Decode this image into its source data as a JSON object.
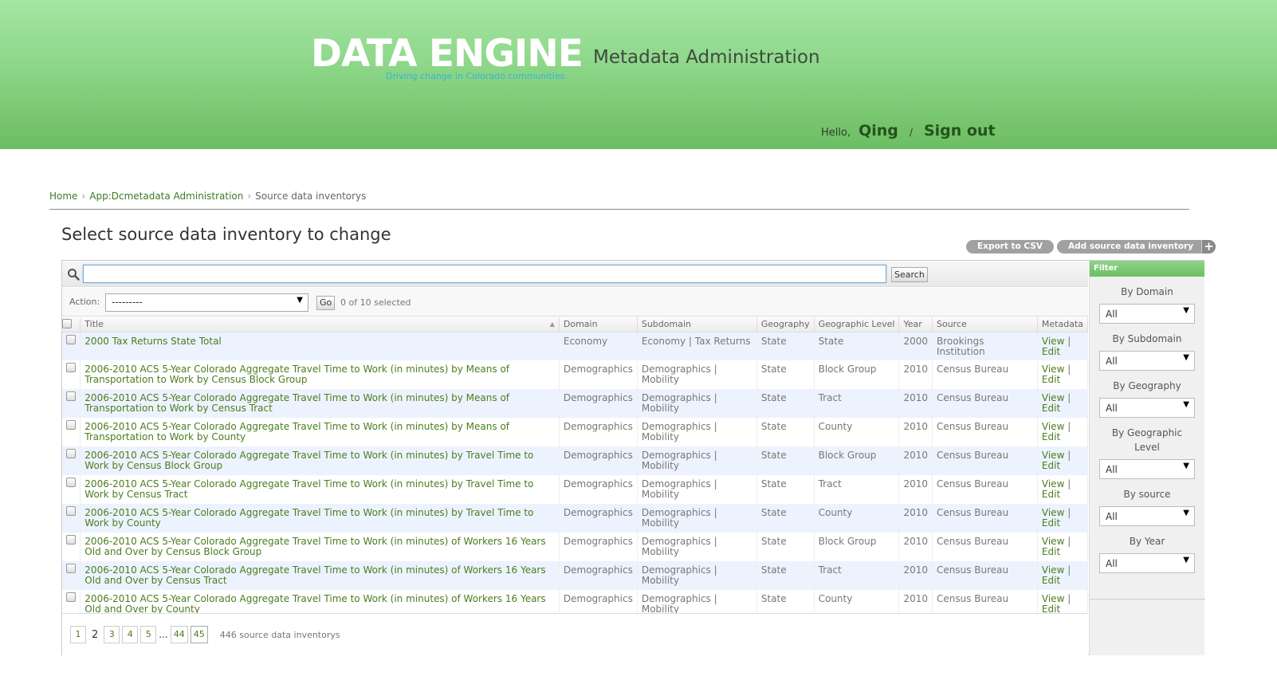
{
  "header": {
    "logo": "DATA ENGINE",
    "tagline": "Driving change in Colorado communities",
    "app_title": "Metadata Administration",
    "greeting": "Hello,",
    "username": "Qing",
    "separator": "/",
    "signout": "Sign out"
  },
  "breadcrumb": {
    "home": "Home",
    "app": "App:Dcmetadata Administration",
    "current": "Source data inventorys",
    "arrow": "›"
  },
  "page_title": "Select source data inventory to change",
  "tools": {
    "export": "Export to CSV",
    "add": "Add source data inventory",
    "add_plus": "+"
  },
  "search": {
    "value": "",
    "placeholder": "",
    "button": "Search"
  },
  "actions": {
    "label": "Action:",
    "selected": "---------",
    "go": "Go",
    "count": "0 of 10 selected"
  },
  "table": {
    "columns": [
      "Title",
      "Domain",
      "Subdomain",
      "Geography",
      "Geographic Level",
      "Year",
      "Source",
      "Metadata"
    ],
    "view_label": "View",
    "edit_label": "Edit",
    "pipe": "|",
    "rows": [
      {
        "title": "2000 Tax Returns State Total",
        "domain": "Economy",
        "subdomain": "Economy | Tax Returns",
        "geography": "State",
        "level": "State",
        "year": "2000",
        "source": "Brookings Institution"
      },
      {
        "title": "2006-2010 ACS 5-Year Colorado Aggregate Travel Time to Work (in minutes) by Means of Transportation to Work by Census Block Group",
        "domain": "Demographics",
        "subdomain": "Demographics | Mobility",
        "geography": "State",
        "level": "Block Group",
        "year": "2010",
        "source": "Census Bureau"
      },
      {
        "title": "2006-2010 ACS 5-Year Colorado Aggregate Travel Time to Work (in minutes) by Means of Transportation to Work by Census Tract",
        "domain": "Demographics",
        "subdomain": "Demographics | Mobility",
        "geography": "State",
        "level": "Tract",
        "year": "2010",
        "source": "Census Bureau"
      },
      {
        "title": "2006-2010 ACS 5-Year Colorado Aggregate Travel Time to Work (in minutes) by Means of Transportation to Work by County",
        "domain": "Demographics",
        "subdomain": "Demographics | Mobility",
        "geography": "State",
        "level": "County",
        "year": "2010",
        "source": "Census Bureau"
      },
      {
        "title": "2006-2010 ACS 5-Year Colorado Aggregate Travel Time to Work (in minutes) by Travel Time to Work by Census Block Group",
        "domain": "Demographics",
        "subdomain": "Demographics | Mobility",
        "geography": "State",
        "level": "Block Group",
        "year": "2010",
        "source": "Census Bureau"
      },
      {
        "title": "2006-2010 ACS 5-Year Colorado Aggregate Travel Time to Work (in minutes) by Travel Time to Work by Census Tract",
        "domain": "Demographics",
        "subdomain": "Demographics | Mobility",
        "geography": "State",
        "level": "Tract",
        "year": "2010",
        "source": "Census Bureau"
      },
      {
        "title": "2006-2010 ACS 5-Year Colorado Aggregate Travel Time to Work (in minutes) by Travel Time to Work by County",
        "domain": "Demographics",
        "subdomain": "Demographics | Mobility",
        "geography": "State",
        "level": "County",
        "year": "2010",
        "source": "Census Bureau"
      },
      {
        "title": "2006-2010 ACS 5-Year Colorado Aggregate Travel Time to Work (in minutes) of Workers 16 Years Old and Over by Census Block Group",
        "domain": "Demographics",
        "subdomain": "Demographics | Mobility",
        "geography": "State",
        "level": "Block Group",
        "year": "2010",
        "source": "Census Bureau"
      },
      {
        "title": "2006-2010 ACS 5-Year Colorado Aggregate Travel Time to Work (in minutes) of Workers 16 Years Old and Over by Census Tract",
        "domain": "Demographics",
        "subdomain": "Demographics | Mobility",
        "geography": "State",
        "level": "Tract",
        "year": "2010",
        "source": "Census Bureau"
      },
      {
        "title": "2006-2010 ACS 5-Year Colorado Aggregate Travel Time to Work (in minutes) of Workers 16 Years Old and Over by County",
        "domain": "Demographics",
        "subdomain": "Demographics | Mobility",
        "geography": "State",
        "level": "County",
        "year": "2010",
        "source": "Census Bureau"
      }
    ]
  },
  "paginator": {
    "pages_before": [
      "1"
    ],
    "current": "2",
    "pages_after": [
      "3",
      "4",
      "5"
    ],
    "ellipsis": "...",
    "tail": [
      "44",
      "45"
    ],
    "count": "446 source data inventorys"
  },
  "filter": {
    "title": "Filter",
    "groups": [
      {
        "label": "By Domain",
        "value": "All"
      },
      {
        "label": "By Subdomain",
        "value": "All"
      },
      {
        "label": "By Geography",
        "value": "All"
      },
      {
        "label": "By Geographic Level",
        "value": "All"
      },
      {
        "label": "By source",
        "value": "All"
      },
      {
        "label": "By Year",
        "value": "All"
      }
    ]
  },
  "icons": {
    "search": "search-icon",
    "dropdown": "chevron-down-icon",
    "sort": "sort-ascending-icon",
    "caret_glyph": "▼",
    "sort_glyph": "▲"
  }
}
